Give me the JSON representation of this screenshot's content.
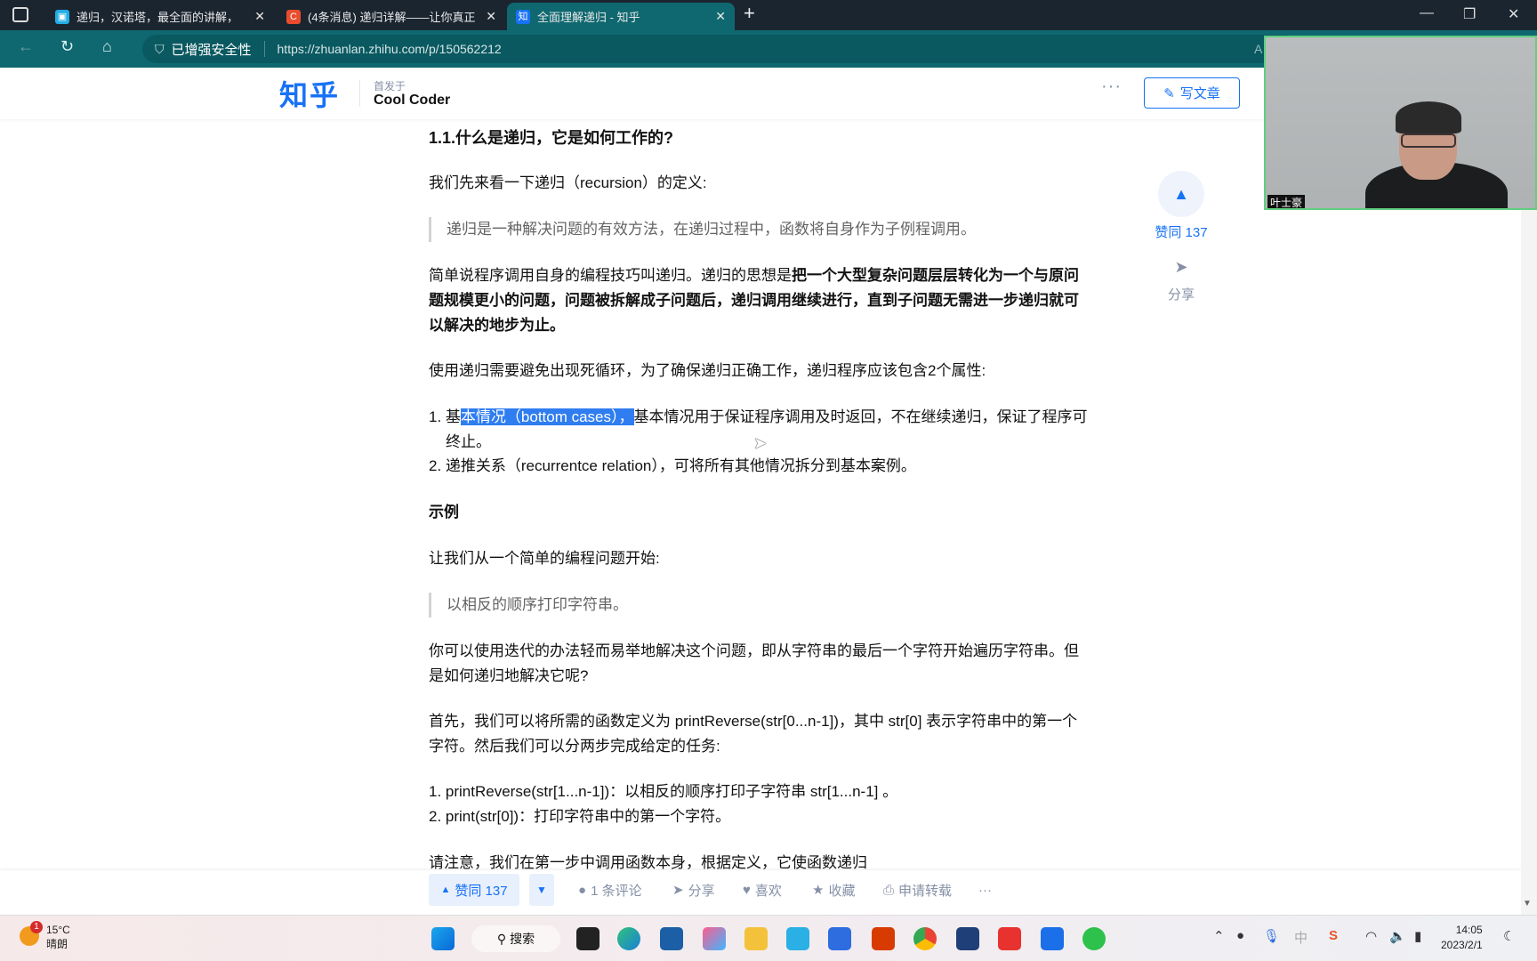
{
  "browser": {
    "tabs": [
      {
        "title": "递归，汉诺塔，最全面的讲解，",
        "icon": "bilibili-icon",
        "active": false
      },
      {
        "title": "(4条消息) 递归详解——让你真正",
        "icon": "csdn-icon",
        "active": false
      },
      {
        "title": "全面理解递归 - 知乎",
        "icon": "zhihu-icon",
        "active": true
      }
    ],
    "security_label": "已增强安全性",
    "url": "https://zhuanlan.zhihu.com/p/150562212",
    "reader_label": "A"
  },
  "header": {
    "logo": "知乎",
    "first_published": "首发于",
    "column": "Cool Coder",
    "more": "···",
    "write_label": "写文章"
  },
  "article": {
    "heading": "1.1.什么是递归，它是如何工作的?",
    "p1": "我们先来看一下递归（recursion）的定义:",
    "quote1": "递归是一种解决问题的有效方法，在递归过程中，函数将自身作为子例程调用。",
    "p2_normal": "简单说程序调用自身的编程技巧叫递归。递归的思想是",
    "p2_bold": "把一个大型复杂问题层层转化为一个与原问题规模更小的问题，问题被拆解成子问题后，递归调用继续进行，直到子问题无需进一步递归就可以解决的地步为止。",
    "p3": "使用递归需要避免出现死循环，为了确保递归正确工作，递归程序应该包含2个属性:",
    "list1_prefix": "1. 基",
    "list1_selected": "本情况（bottom cases），",
    "list1_rest": "基本情况用于保证程序调用及时返回，不在继续递归，保证了程序可终止。",
    "list2": "2. 递推关系（recurrentce relation），可将所有其他情况拆分到基本案例。",
    "example_heading": "示例",
    "p4": "让我们从一个简单的编程问题开始:",
    "quote2": "以相反的顺序打印字符串。",
    "p5": "你可以使用迭代的办法轻而易举地解决这个问题，即从字符串的最后一个字符开始遍历字符串。但是如何递归地解决它呢?",
    "p6": "首先，我们可以将所需的函数定义为 printReverse(str[0...n-1])，其中 str[0] 表示字符串中的第一个字符。然后我们可以分两步完成给定的任务:",
    "step1": "1. printReverse(str[1...n-1])：以相反的顺序打印子字符串 str[1...n-1] 。",
    "step2": "2. print(str[0])：打印字符串中的第一个字符。",
    "p7_partial": "请注意，我们在第一步中调用函数本身，根据定义，它使函数递归"
  },
  "side": {
    "vote_label": "赞同 137",
    "share_label": "分享"
  },
  "actions": {
    "upvote": "赞同 137",
    "comments": "1 条评论",
    "share": "分享",
    "like": "喜欢",
    "favorite": "收藏",
    "reprint": "申请转载",
    "more": "···"
  },
  "webcam": {
    "name": "叶士豪",
    "border_color": "#5fcf80"
  },
  "taskbar": {
    "weather_temp": "15°C",
    "weather_desc": "晴朗",
    "weather_badge": "1",
    "search": "搜索",
    "time": "14:05",
    "date": "2023/2/1",
    "ime": "中"
  },
  "colors": {
    "accent": "#1772f6",
    "browser_chrome": "#0f6870",
    "selection": "#2f7df0"
  }
}
